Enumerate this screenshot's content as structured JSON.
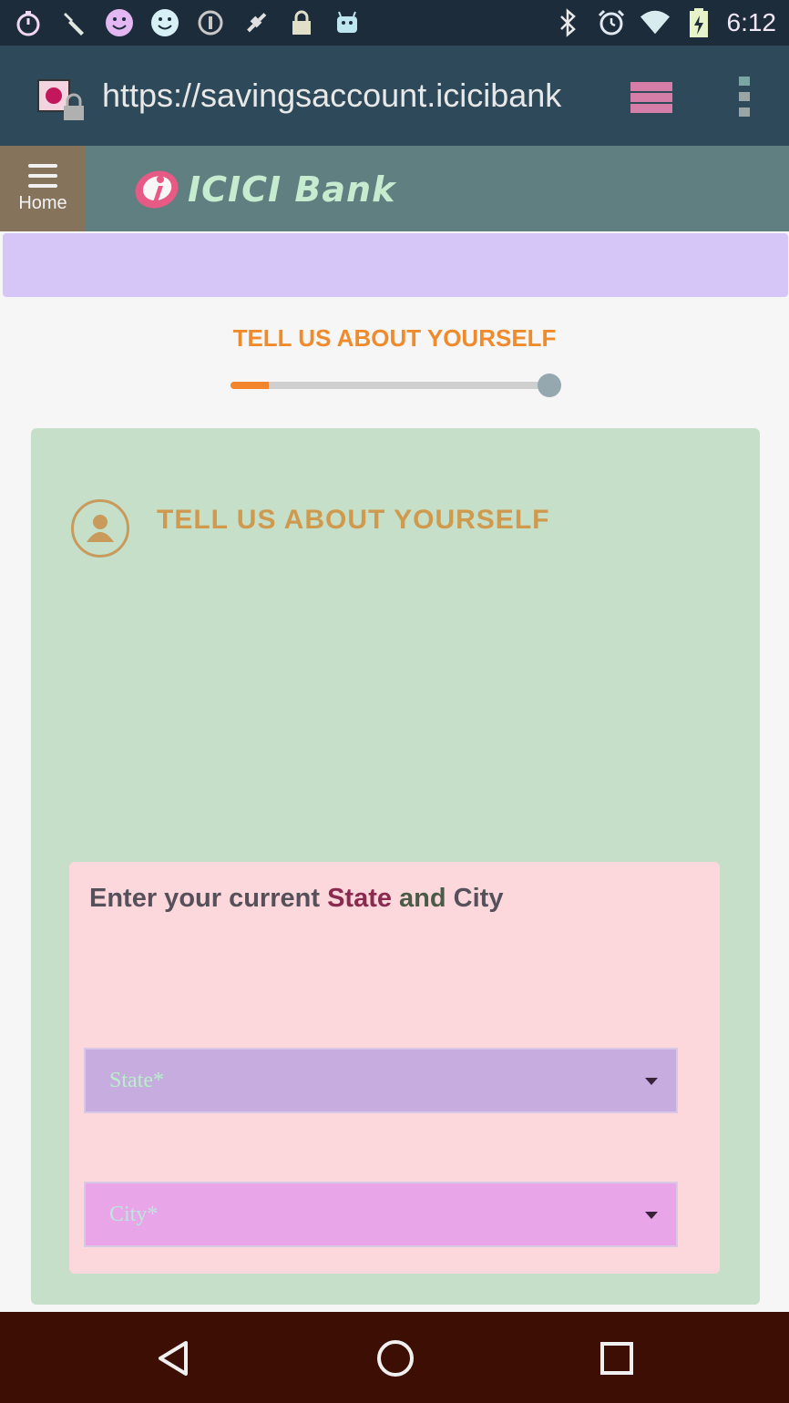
{
  "status_bar": {
    "time": "6:12",
    "left_icons": [
      "stopwatch-icon",
      "wrench-icon",
      "smiley-icon",
      "smiley-icon",
      "info-icon",
      "satellite-icon",
      "lock-icon",
      "android-icon"
    ],
    "right_icons": [
      "bluetooth-icon",
      "alarm-icon",
      "wifi-icon",
      "battery-charging-icon"
    ]
  },
  "browser": {
    "url": "https://savingsaccount.icicibank"
  },
  "header": {
    "home_label": "Home",
    "logo_text": "ICICI Bank"
  },
  "step": {
    "title": "TELL US ABOUT YOURSELF",
    "progress_percent": 12
  },
  "card": {
    "title": "TELL US ABOUT YOURSELF",
    "question_prefix": "Enter your current ",
    "question_state": "State",
    "question_and": " and ",
    "question_city": "City",
    "state_placeholder": "State*",
    "city_placeholder": "City*"
  },
  "colors": {
    "accent": "#ef8b2c",
    "header_bg": "#5f7f80",
    "home_bg": "#86735c",
    "card_bg": "#c6dfc9",
    "inner_card_bg": "#fcd7dc",
    "nav_bg": "#3d0f04"
  }
}
